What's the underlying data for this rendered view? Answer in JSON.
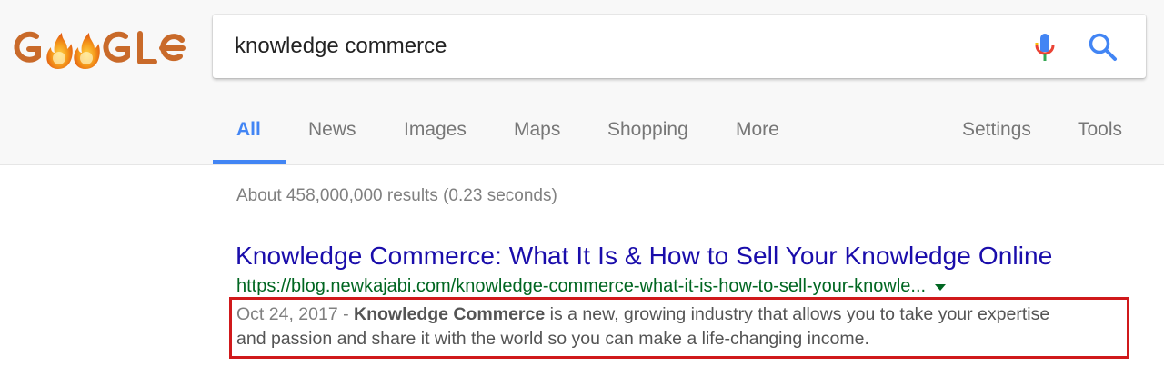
{
  "logo": {
    "text": "GOOGLE",
    "icon": "flame-logo-icon"
  },
  "search": {
    "query": "knowledge commerce",
    "mic_icon": "microphone-icon",
    "search_icon": "search-icon"
  },
  "tabs": [
    {
      "label": "All",
      "active": true
    },
    {
      "label": "News"
    },
    {
      "label": "Images"
    },
    {
      "label": "Maps"
    },
    {
      "label": "Shopping"
    },
    {
      "label": "More"
    },
    {
      "label": "Settings"
    },
    {
      "label": "Tools"
    }
  ],
  "results_stats": "About 458,000,000 results (0.23 seconds)",
  "result": {
    "title": "Knowledge Commerce: What It Is & How to Sell Your Knowledge Online",
    "url": "https://blog.newkajabi.com/knowledge-commerce-what-it-is-how-to-sell-your-knowle...",
    "date": "Oct 24, 2017 - ",
    "snippet_bold": "Knowledge Commerce",
    "snippet_rest_1": " is a new, growing industry that allows you to take your expertise",
    "snippet_rest_2": "and passion and share it with the world so you can make a life-changing income."
  },
  "colors": {
    "link": "#1a0dab",
    "url": "#006621",
    "active_tab": "#4285f4",
    "highlight": "#d0191b"
  }
}
